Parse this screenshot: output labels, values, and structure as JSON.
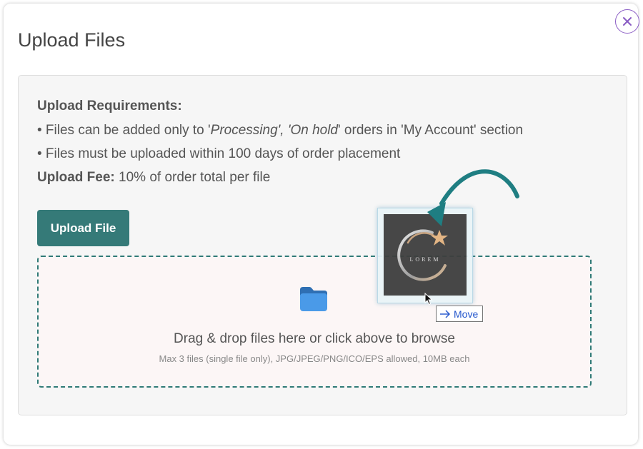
{
  "dialog": {
    "title": "Upload Files",
    "close_icon": "close-x-icon"
  },
  "requirements": {
    "heading": "Upload Requirements:",
    "line1_prefix": "• Files can be added only to '",
    "line1_status1": "Processing', 'On hold",
    "line1_suffix": "' orders in 'My Account' section",
    "line2": "• Files must be uploaded within 100 days of order placement",
    "fee_label": "Upload Fee:",
    "fee_value": " 10% of order total per file"
  },
  "upload_button": {
    "label": "Upload File"
  },
  "dropzone": {
    "icon": "folder-icon",
    "text": "Drag & drop files here or click above to browse",
    "hint": "Max 3 files (single file only), JPG/JPEG/PNG/ICO/EPS allowed, 10MB each"
  },
  "drag_preview": {
    "logo_text": "LOREM",
    "tooltip_icon": "arrow-right-icon",
    "tooltip_label": "Move"
  },
  "colors": {
    "accent": "#357a78",
    "close_border": "#8a5cc4",
    "arrow": "#1f7e82",
    "tooltip_text": "#2255cc"
  }
}
